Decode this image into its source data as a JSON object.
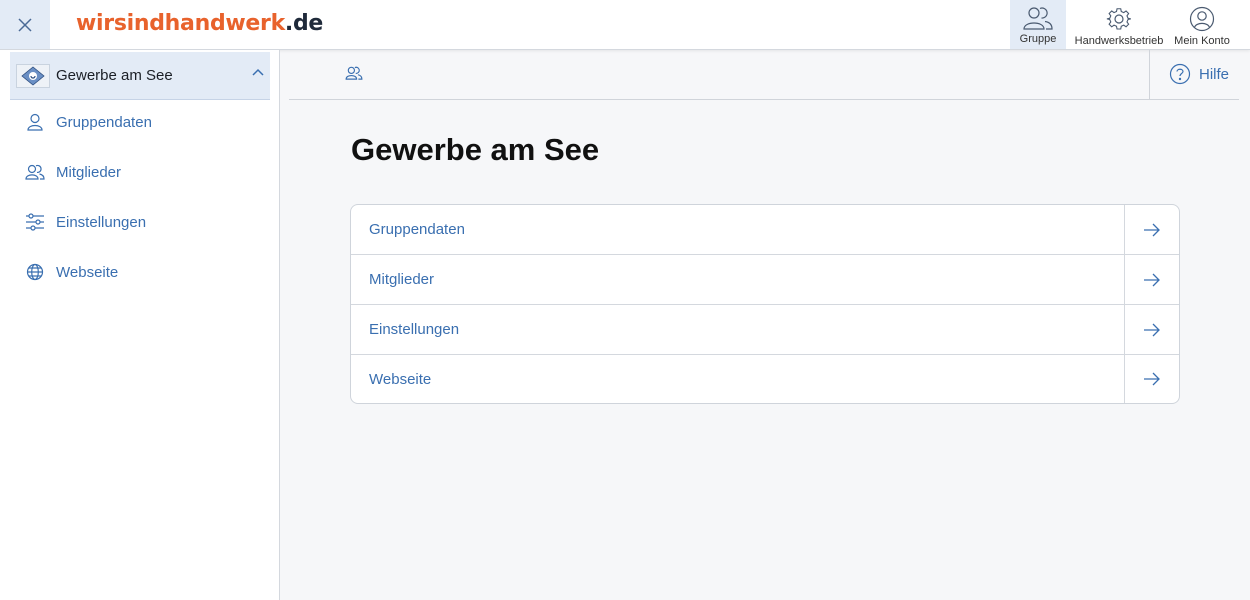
{
  "header": {
    "logo_part1": "wirsind",
    "logo_part2": "handwerk",
    "logo_part3": ".de",
    "nav": [
      {
        "label": "Gruppe",
        "icon": "group-icon",
        "active": true
      },
      {
        "label": "Handwerksbetrieb",
        "icon": "gear-icon",
        "active": false
      },
      {
        "label": "Mein Konto",
        "icon": "user-circle-icon",
        "active": false
      }
    ]
  },
  "sidebar": {
    "group_name": "Gewerbe am See",
    "items": [
      {
        "label": "Gruppendaten",
        "icon": "user-icon"
      },
      {
        "label": "Mitglieder",
        "icon": "users-icon"
      },
      {
        "label": "Einstellungen",
        "icon": "sliders-icon"
      },
      {
        "label": "Webseite",
        "icon": "globe-icon"
      }
    ]
  },
  "main": {
    "help_label": "Hilfe",
    "title": "Gewerbe am See",
    "rows": [
      {
        "label": "Gruppendaten"
      },
      {
        "label": "Mitglieder"
      },
      {
        "label": "Einstellungen"
      },
      {
        "label": "Webseite"
      }
    ]
  },
  "colors": {
    "brand_orange": "#e8622c",
    "link_blue": "#3a6fb0",
    "active_bg": "#e3ebf6"
  }
}
